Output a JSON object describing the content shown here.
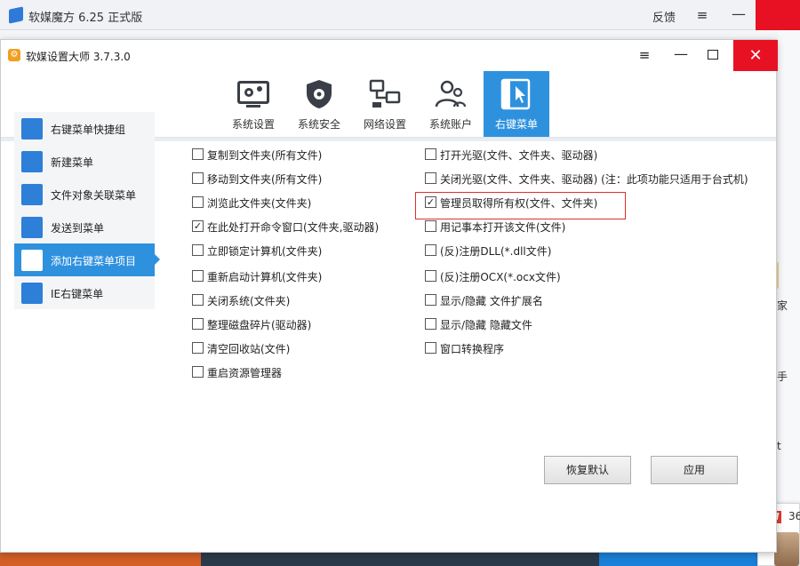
{
  "outer_app": {
    "title": "软媒魔方 6.25 正式版",
    "feedback": "反馈",
    "menu_icon": "≡",
    "minimize_icon": "—"
  },
  "background_fragments": {
    "right_texts": [
      "家",
      "手",
      "t"
    ],
    "notification_number": "36",
    "notification_badge": "N"
  },
  "window": {
    "title": "软媒设置大师 3.7.3.0",
    "app_icon": "⚙",
    "menu_icon": "≡",
    "minimize_icon": "—",
    "close_icon": "✕"
  },
  "tabs": [
    {
      "label": "系统设置",
      "icon": "system-settings-icon",
      "active": false
    },
    {
      "label": "系统安全",
      "icon": "shield-icon",
      "active": false
    },
    {
      "label": "网络设置",
      "icon": "network-icon",
      "active": false
    },
    {
      "label": "系统账户",
      "icon": "users-icon",
      "active": false
    },
    {
      "label": "右键菜单",
      "icon": "cursor-icon",
      "active": true
    }
  ],
  "sidebar": {
    "items": [
      {
        "label": "右键菜单快捷组",
        "icon": "menu-group-icon",
        "active": false
      },
      {
        "label": "新建菜单",
        "icon": "new-menu-icon",
        "active": false
      },
      {
        "label": "文件对象关联菜单",
        "icon": "list-icon",
        "active": false
      },
      {
        "label": "发送到菜单",
        "icon": "send-to-icon",
        "active": false
      },
      {
        "label": "添加右键菜单项目",
        "icon": "add-icon",
        "active": true
      },
      {
        "label": "IE右键菜单",
        "icon": "ie-icon",
        "active": false
      }
    ]
  },
  "options_left": [
    {
      "label": "复制到文件夹(所有文件)",
      "checked": false
    },
    {
      "label": "移动到文件夹(所有文件)",
      "checked": false
    },
    {
      "label": "浏览此文件夹(文件夹)",
      "checked": false
    },
    {
      "label": "在此处打开命令窗口(文件夹,驱动器)",
      "checked": true
    },
    {
      "label": "立即锁定计算机(文件夹)",
      "checked": false
    },
    {
      "label": "重新启动计算机(文件夹)",
      "checked": false
    },
    {
      "label": "关闭系统(文件夹)",
      "checked": false
    },
    {
      "label": "整理磁盘碎片(驱动器)",
      "checked": false
    },
    {
      "label": "清空回收站(文件)",
      "checked": false
    },
    {
      "label": "重启资源管理器",
      "checked": false
    }
  ],
  "options_right": [
    {
      "label": "打开光驱(文件、文件夹、驱动器)",
      "checked": false
    },
    {
      "label": "关闭光驱(文件、文件夹、驱动器) (注：此项功能只适用于台式机)",
      "checked": false
    },
    {
      "label": "管理员取得所有权(文件、文件夹)",
      "checked": true
    },
    {
      "label": "用记事本打开该文件(文件)",
      "checked": false
    },
    {
      "label": "(反)注册DLL(*.dll文件)",
      "checked": false
    },
    {
      "label": "(反)注册OCX(*.ocx文件)",
      "checked": false
    },
    {
      "label": "显示/隐藏 文件扩展名",
      "checked": false
    },
    {
      "label": "显示/隐藏 隐藏文件",
      "checked": false
    },
    {
      "label": "窗口转换程序",
      "checked": false
    }
  ],
  "buttons": {
    "restore_default": "恢复默认",
    "apply": "应用"
  },
  "colors": {
    "accent": "#2e91de",
    "close_red": "#e81123",
    "highlight_red": "#e0302a"
  }
}
